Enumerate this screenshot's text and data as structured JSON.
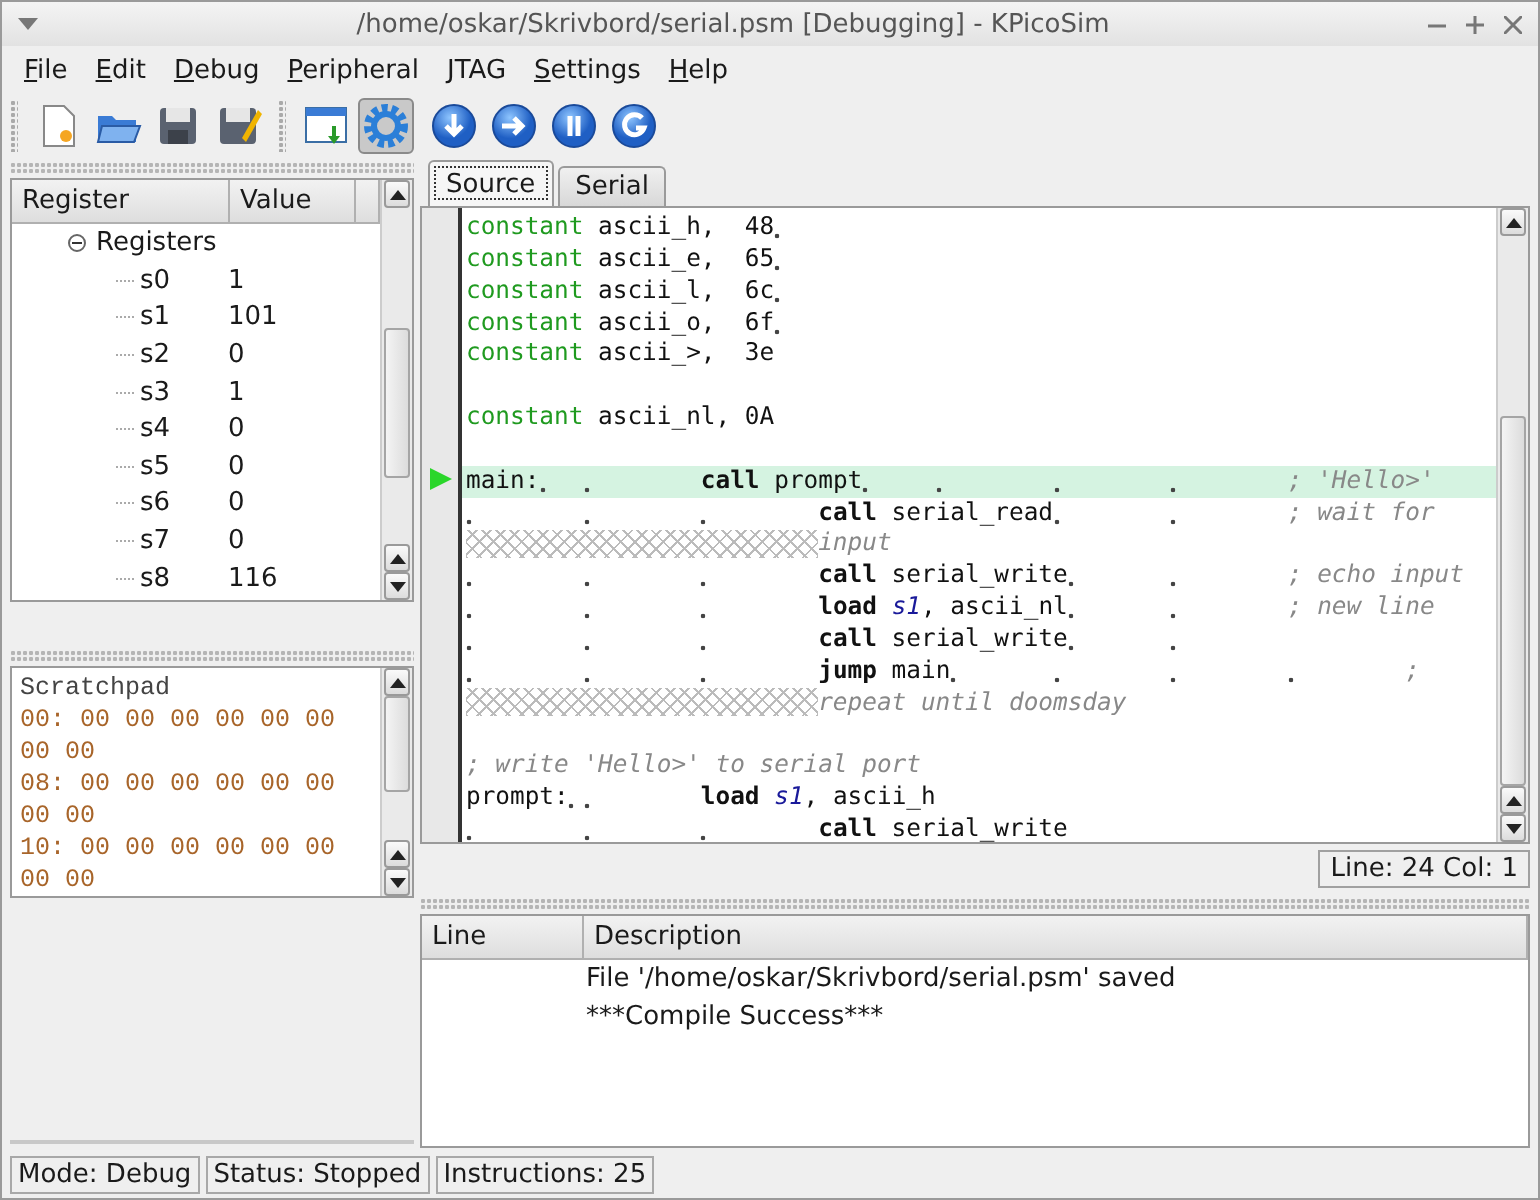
{
  "window": {
    "title": "/home/oskar/Skrivbord/serial.psm [Debugging] - KPicoSim"
  },
  "menu": [
    "File",
    "Edit",
    "Debug",
    "Peripheral",
    "JTAG",
    "Settings",
    "Help"
  ],
  "toolbar": [
    [
      {
        "kind": "new",
        "pressed": false
      },
      {
        "kind": "open",
        "pressed": false
      },
      {
        "kind": "save",
        "pressed": false
      },
      {
        "kind": "saveas",
        "pressed": false
      }
    ],
    [
      {
        "kind": "compile",
        "pressed": false
      },
      {
        "kind": "debug",
        "pressed": true
      }
    ],
    [
      {
        "kind": "step",
        "pressed": false
      },
      {
        "kind": "next",
        "pressed": false
      },
      {
        "kind": "pause",
        "pressed": false
      },
      {
        "kind": "reset",
        "pressed": false
      }
    ]
  ],
  "registers": {
    "columns": [
      "Register",
      "Value"
    ],
    "root": {
      "label": "Registers",
      "expanded": true,
      "children": [
        {
          "name": "s0",
          "value": "1"
        },
        {
          "name": "s1",
          "value": "101"
        },
        {
          "name": "s2",
          "value": "0"
        },
        {
          "name": "s3",
          "value": "1"
        },
        {
          "name": "s4",
          "value": "0"
        },
        {
          "name": "s5",
          "value": "0"
        },
        {
          "name": "s6",
          "value": "0"
        },
        {
          "name": "s7",
          "value": "0"
        },
        {
          "name": "s8",
          "value": "116"
        }
      ]
    }
  },
  "scratchpad": {
    "title": "Scratchpad",
    "lines": [
      "00: 00 00 00 00 00 00 00 00",
      "08: 00 00 00 00 00 00 00 00",
      "10: 00 00 00 00 00 00 00 00"
    ]
  },
  "tabs": [
    {
      "label": "Source",
      "selected": true
    },
    {
      "label": "Serial",
      "selected": false
    }
  ],
  "code": [
    {
      "kind": "code",
      "current": false,
      "segments": [
        {
          "kind": "keyword",
          "text": "constant"
        },
        {
          "kind": "text",
          "text": " ascii_h,  48"
        },
        {
          "kind": "tab"
        }
      ]
    },
    {
      "kind": "code",
      "current": false,
      "segments": [
        {
          "kind": "keyword",
          "text": "constant"
        },
        {
          "kind": "text",
          "text": " ascii_e,  65"
        },
        {
          "kind": "tab"
        }
      ]
    },
    {
      "kind": "code",
      "current": false,
      "segments": [
        {
          "kind": "keyword",
          "text": "constant"
        },
        {
          "kind": "text",
          "text": " ascii_l,  6c"
        },
        {
          "kind": "tab"
        }
      ]
    },
    {
      "kind": "code",
      "current": false,
      "segments": [
        {
          "kind": "keyword",
          "text": "constant"
        },
        {
          "kind": "text",
          "text": " ascii_o,  6f"
        },
        {
          "kind": "tab"
        }
      ]
    },
    {
      "kind": "code",
      "current": false,
      "segments": [
        {
          "kind": "keyword",
          "text": "constant"
        },
        {
          "kind": "text",
          "text": " ascii_>,  3e"
        }
      ]
    },
    {
      "kind": "blank"
    },
    {
      "kind": "code",
      "current": false,
      "segments": [
        {
          "kind": "keyword",
          "text": "constant"
        },
        {
          "kind": "text",
          "text": " ascii_nl, 0A"
        }
      ]
    },
    {
      "kind": "blank"
    },
    {
      "kind": "code",
      "current": true,
      "segments": [
        {
          "kind": "text",
          "text": "main:"
        },
        {
          "kind": "tab"
        },
        {
          "kind": "tab"
        },
        {
          "kind": "instr",
          "text": "call"
        },
        {
          "kind": "text",
          "text": " prompt"
        },
        {
          "kind": "tab"
        },
        {
          "kind": "tab"
        },
        {
          "kind": "tab"
        },
        {
          "kind": "tab"
        },
        {
          "kind": "comment",
          "text": "; 'Hello>'"
        }
      ]
    },
    {
      "kind": "code",
      "current": false,
      "segments": [
        {
          "kind": "tab"
        },
        {
          "kind": "tab"
        },
        {
          "kind": "tab"
        },
        {
          "kind": "instr",
          "text": "call"
        },
        {
          "kind": "text",
          "text": " serial_read"
        },
        {
          "kind": "tab"
        },
        {
          "kind": "tab"
        },
        {
          "kind": "comment",
          "text": "; wait for"
        }
      ]
    },
    {
      "kind": "code",
      "current": false,
      "segments": [
        {
          "kind": "wrap"
        },
        {
          "kind": "comment",
          "text": "input"
        }
      ]
    },
    {
      "kind": "code",
      "current": false,
      "segments": [
        {
          "kind": "tab"
        },
        {
          "kind": "tab"
        },
        {
          "kind": "tab"
        },
        {
          "kind": "instr",
          "text": "call"
        },
        {
          "kind": "text",
          "text": " serial_write"
        },
        {
          "kind": "tab"
        },
        {
          "kind": "tab"
        },
        {
          "kind": "comment",
          "text": "; echo input"
        }
      ]
    },
    {
      "kind": "code",
      "current": false,
      "segments": [
        {
          "kind": "tab"
        },
        {
          "kind": "tab"
        },
        {
          "kind": "tab"
        },
        {
          "kind": "instr",
          "text": "load"
        },
        {
          "kind": "space"
        },
        {
          "kind": "reg",
          "text": "s1"
        },
        {
          "kind": "text",
          "text": ", ascii_nl"
        },
        {
          "kind": "tab"
        },
        {
          "kind": "tab"
        },
        {
          "kind": "comment",
          "text": "; new line"
        }
      ]
    },
    {
      "kind": "code",
      "current": false,
      "segments": [
        {
          "kind": "tab"
        },
        {
          "kind": "tab"
        },
        {
          "kind": "tab"
        },
        {
          "kind": "instr",
          "text": "call"
        },
        {
          "kind": "text",
          "text": " serial_write"
        },
        {
          "kind": "tab"
        },
        {
          "kind": "tab"
        }
      ]
    },
    {
      "kind": "code",
      "current": false,
      "segments": [
        {
          "kind": "tab"
        },
        {
          "kind": "tab"
        },
        {
          "kind": "tab"
        },
        {
          "kind": "instr",
          "text": "jump"
        },
        {
          "kind": "text",
          "text": " main"
        },
        {
          "kind": "tab"
        },
        {
          "kind": "tab"
        },
        {
          "kind": "tab"
        },
        {
          "kind": "tab"
        },
        {
          "kind": "comment",
          "text": ";"
        }
      ]
    },
    {
      "kind": "code",
      "current": false,
      "segments": [
        {
          "kind": "wrap"
        },
        {
          "kind": "comment",
          "text": "repeat until doomsday"
        }
      ]
    },
    {
      "kind": "blank"
    },
    {
      "kind": "code",
      "current": false,
      "segments": [
        {
          "kind": "comment",
          "text": "; write 'Hello>' to serial port"
        }
      ]
    },
    {
      "kind": "code",
      "current": false,
      "segments": [
        {
          "kind": "text",
          "text": "prompt:"
        },
        {
          "kind": "tab"
        },
        {
          "kind": "tab"
        },
        {
          "kind": "instr",
          "text": "load"
        },
        {
          "kind": "space"
        },
        {
          "kind": "reg",
          "text": "s1"
        },
        {
          "kind": "text",
          "text": ", ascii_h"
        }
      ]
    },
    {
      "kind": "code",
      "current": false,
      "segments": [
        {
          "kind": "tab"
        },
        {
          "kind": "tab"
        },
        {
          "kind": "tab"
        },
        {
          "kind": "instr",
          "text": "call"
        },
        {
          "kind": "text",
          "text": " serial_write"
        }
      ]
    }
  ],
  "cursor": "Line: 24 Col: 1",
  "messages": {
    "columns": [
      "Line",
      "Description"
    ],
    "rows": [
      {
        "description": "File '/home/oskar/Skrivbord/serial.psm' saved"
      },
      {
        "description": "***Compile Success***"
      }
    ]
  },
  "status_bar": [
    "Mode: Debug",
    "Status: Stopped",
    "Instructions: 25"
  ]
}
